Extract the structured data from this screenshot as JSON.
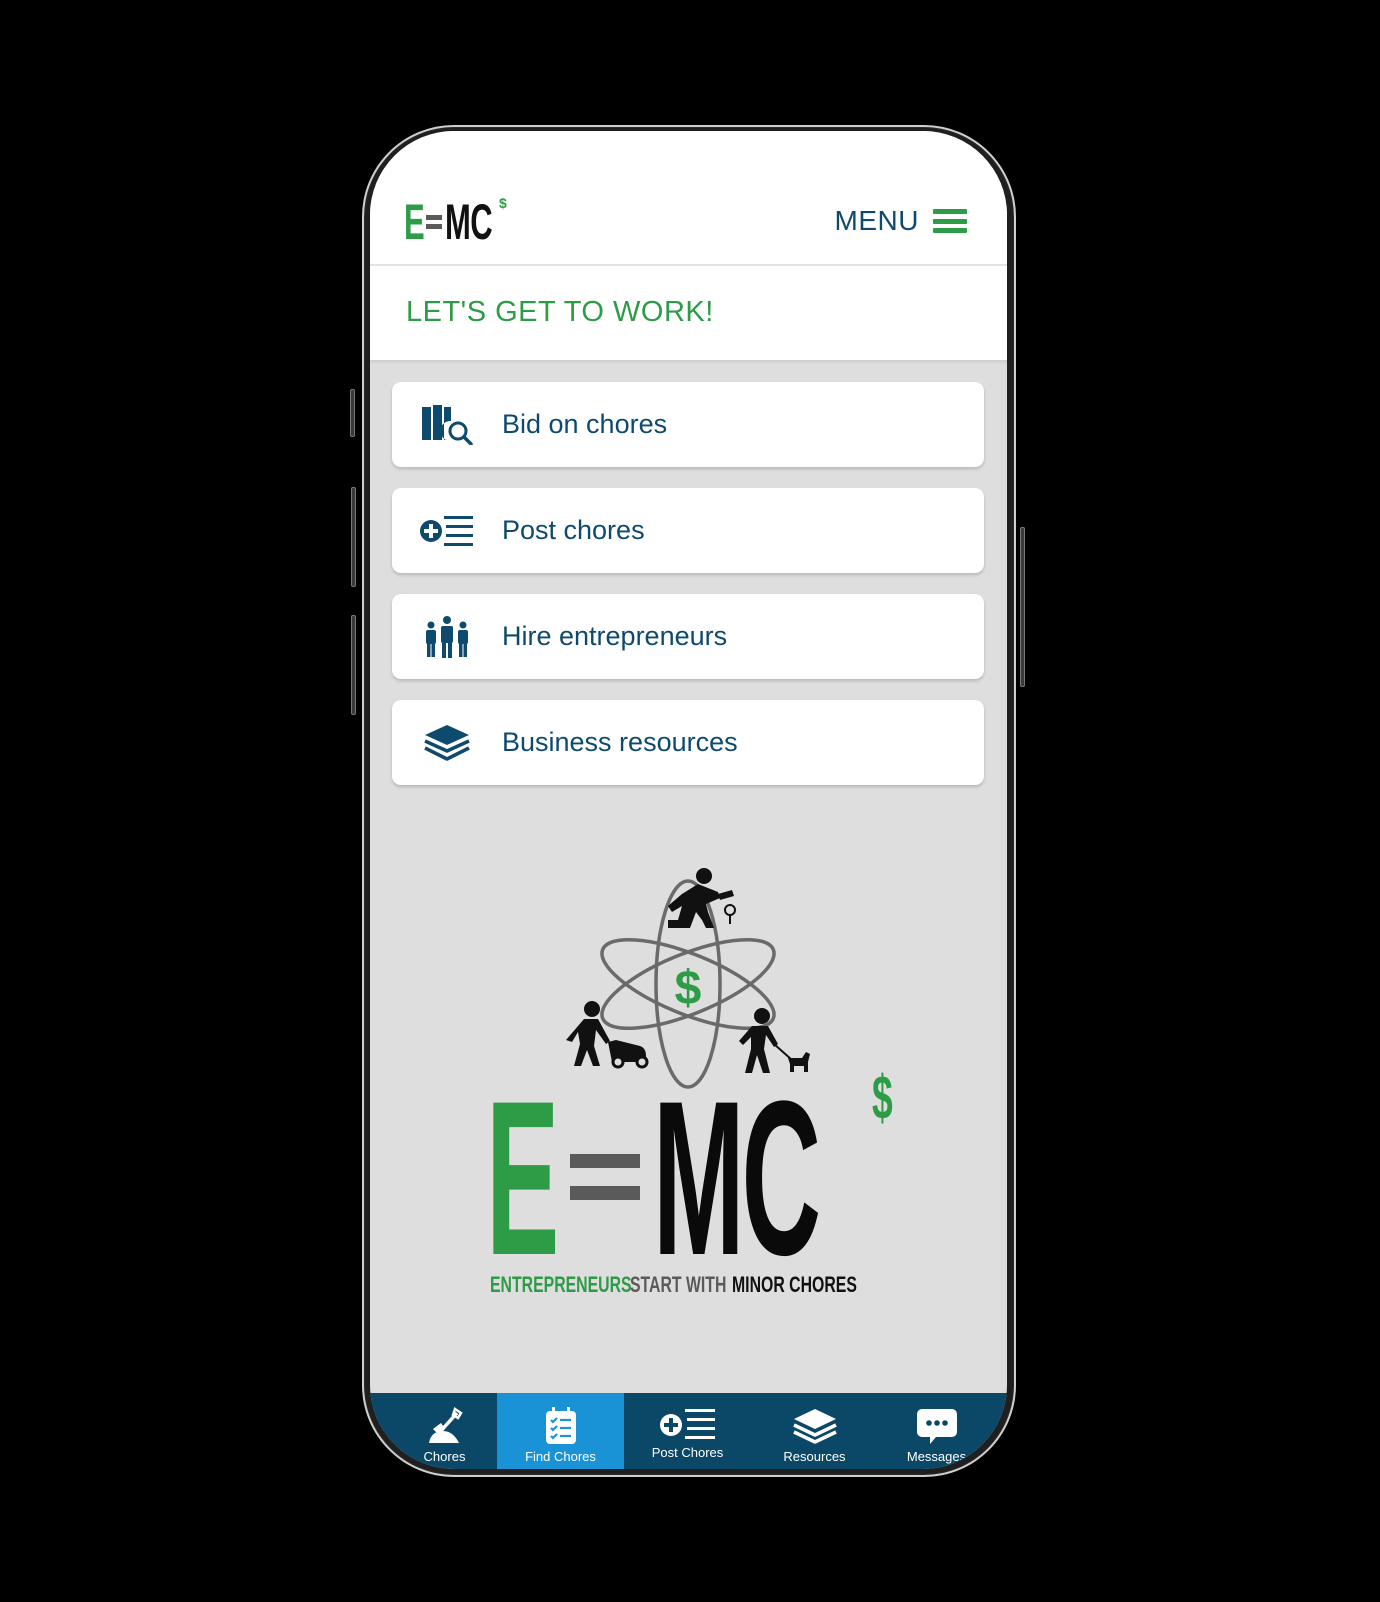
{
  "header": {
    "logo": {
      "e": "E",
      "mc": "MC",
      "superscript": "$"
    },
    "menu_label": "MENU",
    "menu_icon": "hamburger-icon"
  },
  "title_bar": {
    "title": "LET'S GET TO WORK!"
  },
  "cards": [
    {
      "label": "Bid on chores",
      "icon": "map-search-icon"
    },
    {
      "label": "Post chores",
      "icon": "plus-list-icon"
    },
    {
      "label": "Hire entrepreneurs",
      "icon": "people-group-icon"
    },
    {
      "label": "Business resources",
      "icon": "books-stack-icon"
    }
  ],
  "hero": {
    "logo_e": "E",
    "logo_mc": "MC",
    "logo_superscript": "$",
    "center_symbol": "$",
    "tagline_part1": "ENTREPRENEURS",
    "tagline_part2": "START WITH",
    "tagline_part3": "MINOR CHORES"
  },
  "bottom_nav": {
    "items": [
      {
        "label": "Chores",
        "icon": "shovel-icon",
        "active": false
      },
      {
        "label": "Find Chores",
        "icon": "checklist-icon",
        "active": true
      },
      {
        "label": "Post Chores",
        "icon": "plus-list-icon",
        "active": false
      },
      {
        "label": "Resources",
        "icon": "books-stack-icon",
        "active": false
      },
      {
        "label": "Messages",
        "icon": "chat-bubble-icon",
        "active": false
      }
    ]
  },
  "colors": {
    "brand_green": "#2e9b47",
    "brand_blue": "#0e4a6e",
    "nav_bg": "#0b4868",
    "nav_active": "#1a93d6",
    "page_bg": "#dedede"
  }
}
